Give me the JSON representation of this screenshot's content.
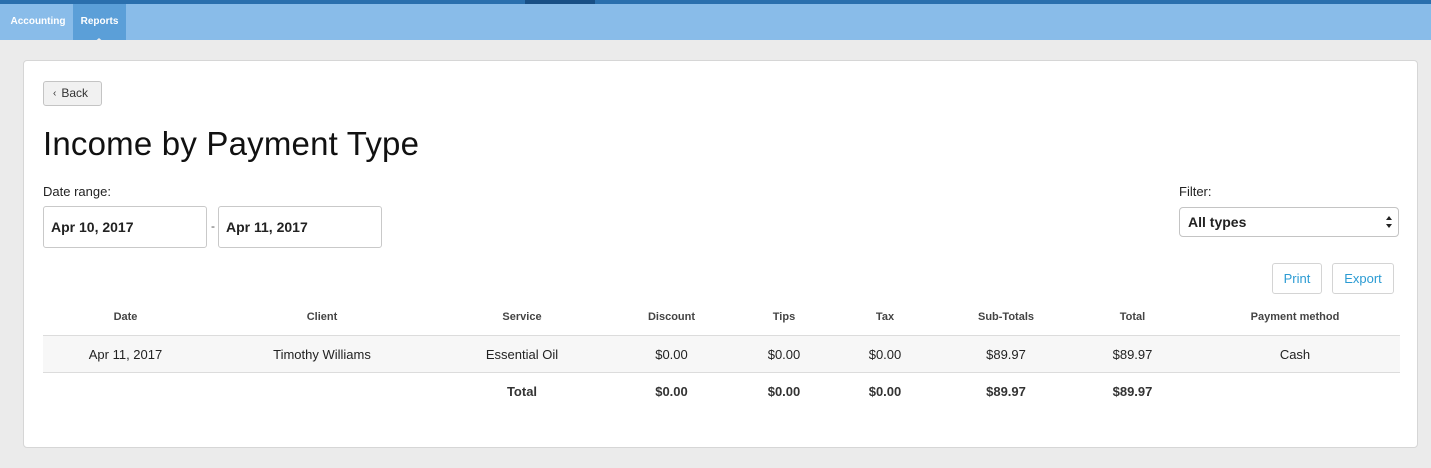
{
  "nav": {
    "tabs": [
      {
        "label": "Accounting"
      },
      {
        "label": "Reports"
      }
    ]
  },
  "back_label": "Back",
  "title": "Income by Payment Type",
  "date_range": {
    "label": "Date range:",
    "start": "Apr 10, 2017",
    "separator": "-",
    "end": "Apr 11, 2017"
  },
  "filter": {
    "label": "Filter:",
    "selected": "All types"
  },
  "actions": {
    "print_label": "Print",
    "export_label": "Export"
  },
  "table": {
    "headers": [
      "Date",
      "Client",
      "Service",
      "Discount",
      "Tips",
      "Tax",
      "Sub-Totals",
      "Total",
      "Payment method"
    ],
    "rows": [
      [
        "Apr 11, 2017",
        "Timothy Williams",
        "Essential Oil",
        "$0.00",
        "$0.00",
        "$0.00",
        "$89.97",
        "$89.97",
        "Cash"
      ]
    ],
    "totals": [
      "",
      "",
      "Total",
      "$0.00",
      "$0.00",
      "$0.00",
      "$89.97",
      "$89.97",
      ""
    ]
  }
}
